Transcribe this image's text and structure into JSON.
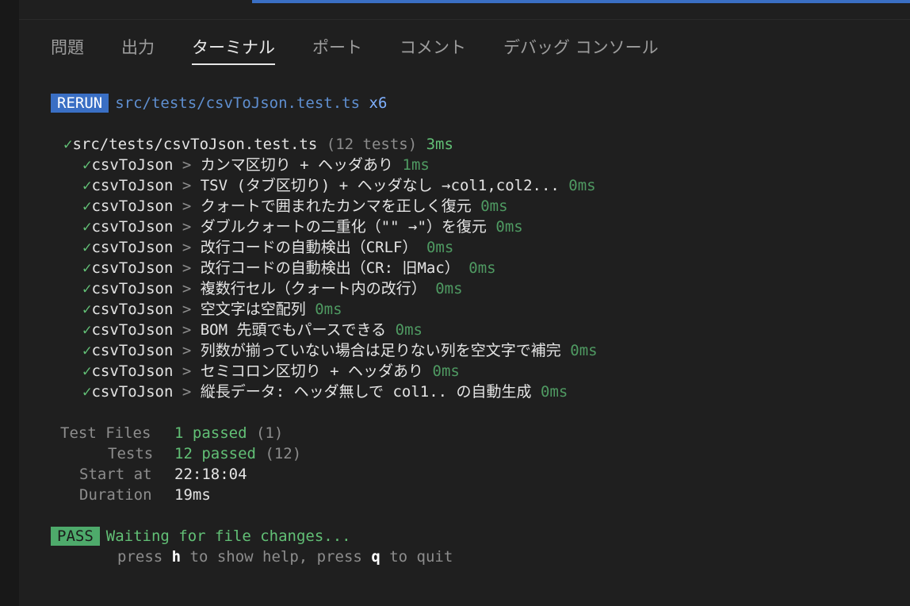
{
  "tabs": [
    {
      "label": "問題",
      "active": false
    },
    {
      "label": "出力",
      "active": false
    },
    {
      "label": "ターミナル",
      "active": true
    },
    {
      "label": "ポート",
      "active": false
    },
    {
      "label": "コメント",
      "active": false
    },
    {
      "label": "デバッグ コンソール",
      "active": false
    }
  ],
  "rerun": {
    "badge": "RERUN",
    "path": "src/tests/csvToJson.test.ts",
    "count": "x6"
  },
  "suite": {
    "check": "✓",
    "path": "src/tests/csvToJson.test.ts",
    "tests": "(12 tests)",
    "time": "3ms"
  },
  "tests": [
    {
      "check": "✓",
      "group": "csvToJson",
      "sep": " > ",
      "name": "カンマ区切り + ヘッダあり",
      "time": "1ms"
    },
    {
      "check": "✓",
      "group": "csvToJson",
      "sep": " > ",
      "name": "TSV (タブ区切り) + ヘッダなし →col1,col2...",
      "time": "0ms"
    },
    {
      "check": "✓",
      "group": "csvToJson",
      "sep": " > ",
      "name": "クォートで囲まれたカンマを正しく復元",
      "time": "0ms"
    },
    {
      "check": "✓",
      "group": "csvToJson",
      "sep": " > ",
      "name": "ダブルクォートの二重化（\"\" →\"）を復元",
      "time": "0ms"
    },
    {
      "check": "✓",
      "group": "csvToJson",
      "sep": " > ",
      "name": "改行コードの自動検出（CRLF）",
      "time": "0ms"
    },
    {
      "check": "✓",
      "group": "csvToJson",
      "sep": " > ",
      "name": "改行コードの自動検出（CR: 旧Mac）",
      "time": "0ms"
    },
    {
      "check": "✓",
      "group": "csvToJson",
      "sep": " > ",
      "name": "複数行セル（クォート内の改行）",
      "time": "0ms"
    },
    {
      "check": "✓",
      "group": "csvToJson",
      "sep": " > ",
      "name": "空文字は空配列",
      "time": "0ms"
    },
    {
      "check": "✓",
      "group": "csvToJson",
      "sep": " > ",
      "name": "BOM 先頭でもパースできる",
      "time": "0ms"
    },
    {
      "check": "✓",
      "group": "csvToJson",
      "sep": " > ",
      "name": "列数が揃っていない場合は足りない列を空文字で補完",
      "time": "0ms"
    },
    {
      "check": "✓",
      "group": "csvToJson",
      "sep": " > ",
      "name": "セミコロン区切り + ヘッダあり",
      "time": "0ms"
    },
    {
      "check": "✓",
      "group": "csvToJson",
      "sep": " > ",
      "name": "縦長データ: ヘッダ無しで col1.. の自動生成",
      "time": "0ms"
    }
  ],
  "summary": {
    "files_label": "Test Files",
    "files_passed": "1 passed",
    "files_total": "(1)",
    "tests_label": "Tests",
    "tests_passed": "12 passed",
    "tests_total": "(12)",
    "start_label": "Start at",
    "start_value": "22:18:04",
    "duration_label": "Duration",
    "duration_value": "19ms"
  },
  "status": {
    "badge": "PASS",
    "message": "Waiting for file changes...",
    "help_press1": "press ",
    "help_key1": "h",
    "help_text1": " to show help, press ",
    "help_key2": "q",
    "help_text2": " to quit"
  },
  "colors": {
    "background": "#1f1f1f",
    "rerun_badge": "#3a6fc4",
    "pass_badge": "#4eaa6b",
    "green": "#62c076",
    "blue": "#5f8fd0"
  }
}
